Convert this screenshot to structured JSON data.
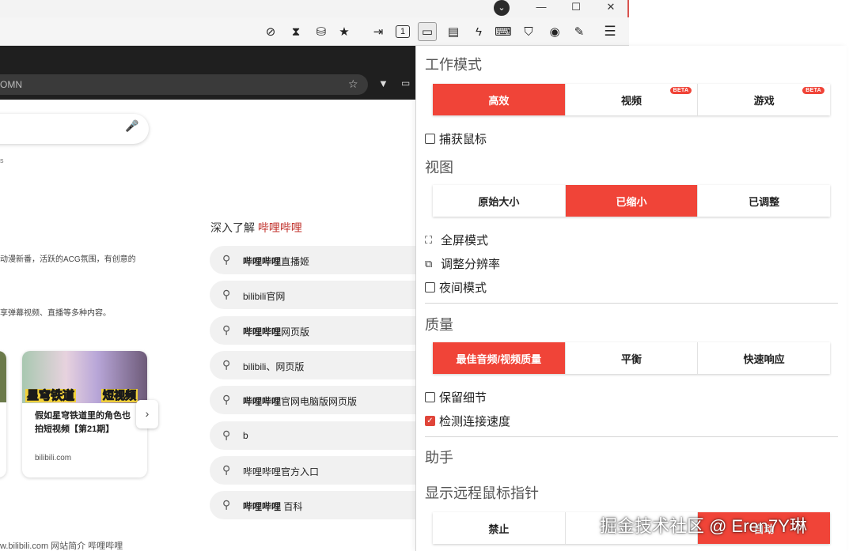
{
  "window": {
    "app_icon_glyph": "⌄",
    "minimize_glyph": "—",
    "maximize_glyph": "☐",
    "close_glyph": "✕"
  },
  "toolbar": {
    "icons": [
      {
        "name": "hide-eye-icon",
        "glyph": "⊘"
      },
      {
        "name": "hourglass-icon",
        "glyph": "⧗"
      },
      {
        "name": "database-icon",
        "glyph": "⛁"
      },
      {
        "name": "star-icon",
        "glyph": "★"
      },
      {
        "name": "export-icon",
        "glyph": "⇥"
      },
      {
        "name": "display-1-icon",
        "glyph": "1"
      },
      {
        "name": "monitor-icon",
        "glyph": "▭"
      },
      {
        "name": "chat-icon",
        "glyph": "▤"
      },
      {
        "name": "lightning-icon",
        "glyph": "ϟ"
      },
      {
        "name": "keyboard-icon",
        "glyph": "⌨"
      },
      {
        "name": "shield-icon",
        "glyph": "⛉"
      },
      {
        "name": "record-icon",
        "glyph": "◉"
      },
      {
        "name": "pen-icon",
        "glyph": "✎"
      },
      {
        "name": "menu-icon",
        "glyph": "☰"
      }
    ]
  },
  "remote_browser": {
    "url_fragment": "OMN",
    "star_glyph": "☆",
    "mic_glyph": "🎙",
    "search_fragment": "s",
    "desc_line_1": "动漫新番，活跃的ACG氛围，有创意的",
    "desc_line_2": "享弹幕视频、直播等多种内容。",
    "card": {
      "banner_left": "星穹铁道",
      "banner_right": "短视频",
      "title": "假如星穹铁道里的角色也拍短视频【第21期】",
      "site": "bilibili.com",
      "next_glyph": "›"
    },
    "explore": {
      "heading_prefix": "深入了解 ",
      "heading_accent": "哔哩哔哩"
    },
    "suggestions": [
      {
        "bold": "哔哩哔哩",
        "rest": "直播姬"
      },
      {
        "bold": "",
        "rest": "bilibili官网"
      },
      {
        "bold": "哔哩哔哩",
        "rest": "网页版"
      },
      {
        "bold": "",
        "rest": "bilibili、网页版"
      },
      {
        "bold": "哔哩哔哩",
        "rest": "官网电脑版网页版"
      },
      {
        "bold": "",
        "rest": "b"
      },
      {
        "bold": "",
        "rest": "哔哩哔哩官方入口"
      },
      {
        "bold": "哔哩哔哩",
        "rest": " 百科"
      }
    ],
    "footer": "w.bilibili.com 网站简介 哔哩哔哩"
  },
  "panel": {
    "work_mode": {
      "title": "工作模式",
      "options": [
        {
          "label": "高效",
          "selected": true,
          "beta": ""
        },
        {
          "label": "视频",
          "selected": false,
          "beta": "BETA"
        },
        {
          "label": "游戏",
          "selected": false,
          "beta": "BETA"
        }
      ],
      "capture_mouse": {
        "label": "捕获鼠标",
        "checked": false
      }
    },
    "view": {
      "title": "视图",
      "options": [
        {
          "label": "原始大小",
          "selected": false
        },
        {
          "label": "已缩小",
          "selected": true
        },
        {
          "label": "已调整",
          "selected": false
        }
      ],
      "fullscreen": "全屏模式",
      "resolution": "调整分辨率",
      "night_mode": {
        "label": "夜间模式",
        "checked": false
      }
    },
    "quality": {
      "title": "质量",
      "options": [
        {
          "label": "最佳音频/视频质量",
          "selected": true
        },
        {
          "label": "平衡",
          "selected": false
        },
        {
          "label": "快速响应",
          "selected": false
        }
      ],
      "keep_detail": {
        "label": "保留细节",
        "checked": false
      },
      "detect_speed": {
        "label": "检测连接速度",
        "checked": true
      }
    },
    "assistant": {
      "title": "助手"
    },
    "remote_pointer": {
      "title": "显示远程鼠标指针",
      "options": [
        {
          "label": "禁止",
          "selected": false
        },
        {
          "label": "",
          "selected": false
        },
        {
          "label": "自动",
          "selected": true
        }
      ]
    },
    "accent_color": "#f04438"
  },
  "watermark": "掘金技术社区 @ Eren7Y琳"
}
